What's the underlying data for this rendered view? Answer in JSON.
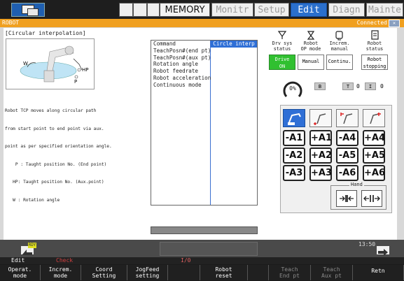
{
  "top_tabs": {
    "mode": "MEMORY",
    "tabs": [
      "Monitr",
      "Setup",
      "Edit",
      "Diagn",
      "Mainte"
    ],
    "active": "Edit"
  },
  "title_bar": {
    "left": "ROBOT",
    "right": "Connected"
  },
  "left_pane": {
    "title": "[Circular interpolation]",
    "illus_labels": {
      "w": "W",
      "hp": "HP",
      "p": "P"
    },
    "description_lines": [
      "Robot TCP moves along circular path",
      "from start point to end point via aux.",
      "point as per specified orientation angle.",
      "    P : Taught position No. (End point)",
      "   HP: Taught position No. (Aux.point)",
      "   W : Rotation angle"
    ]
  },
  "command_list": {
    "header": "Command",
    "items": [
      "TeachPosn#(end pt)",
      "TeachPosn#(aux pt)",
      "Rotation angle",
      "Robot feedrate",
      "Robot acceleration",
      "Continuous mode"
    ],
    "selected_value": "Circle interp"
  },
  "status": [
    {
      "label": "Drv sys\nstatus",
      "value": "Drive\nON",
      "on": true,
      "icon": "drive-icon"
    },
    {
      "label": "Robot\nOP mode",
      "value": "Manual",
      "on": false,
      "icon": "robot-mode-icon"
    },
    {
      "label": "Increm.\nmanual",
      "value": "Continu.",
      "on": false,
      "icon": "increment-icon"
    },
    {
      "label": "Robot\nstatus",
      "value": "Robot\nstopping",
      "on": false,
      "icon": "status-doc-icon"
    }
  ],
  "gauge": {
    "value": "0%",
    "fraction": 0.0
  },
  "indicators": [
    {
      "key": "B",
      "value": ""
    },
    {
      "key": "T",
      "value": "0"
    },
    {
      "key": "I",
      "value": "0"
    }
  ],
  "jog": {
    "rows": [
      [
        "-A1",
        "+A1",
        "-A4",
        "+A4"
      ],
      [
        "-A2",
        "+A2",
        "-A5",
        "+A5"
      ],
      [
        "-A3",
        "+A3",
        "-A6",
        "+A6"
      ]
    ],
    "hand_label": "Hand"
  },
  "status_strip": {
    "rdy": "RDY",
    "clock": "13:50"
  },
  "mode_line": {
    "edit": "Edit",
    "check": "Check",
    "io": "I/0"
  },
  "softkeys": [
    {
      "label": "Operat.\nmode",
      "dim": false
    },
    {
      "label": "Increm.\nmode",
      "dim": false
    },
    {
      "label": "Coord\nSetting",
      "dim": false
    },
    {
      "label": "JogFeed\nsetting",
      "dim": false
    },
    {
      "label": "",
      "dim": false
    },
    {
      "label": "Robot\nreset",
      "dim": false
    },
    {
      "label": "",
      "dim": false
    },
    {
      "label": "Teach\nEnd pt",
      "dim": true
    },
    {
      "label": "Teach\nAux pt",
      "dim": true
    },
    {
      "label": "Retn",
      "dim": false
    }
  ]
}
